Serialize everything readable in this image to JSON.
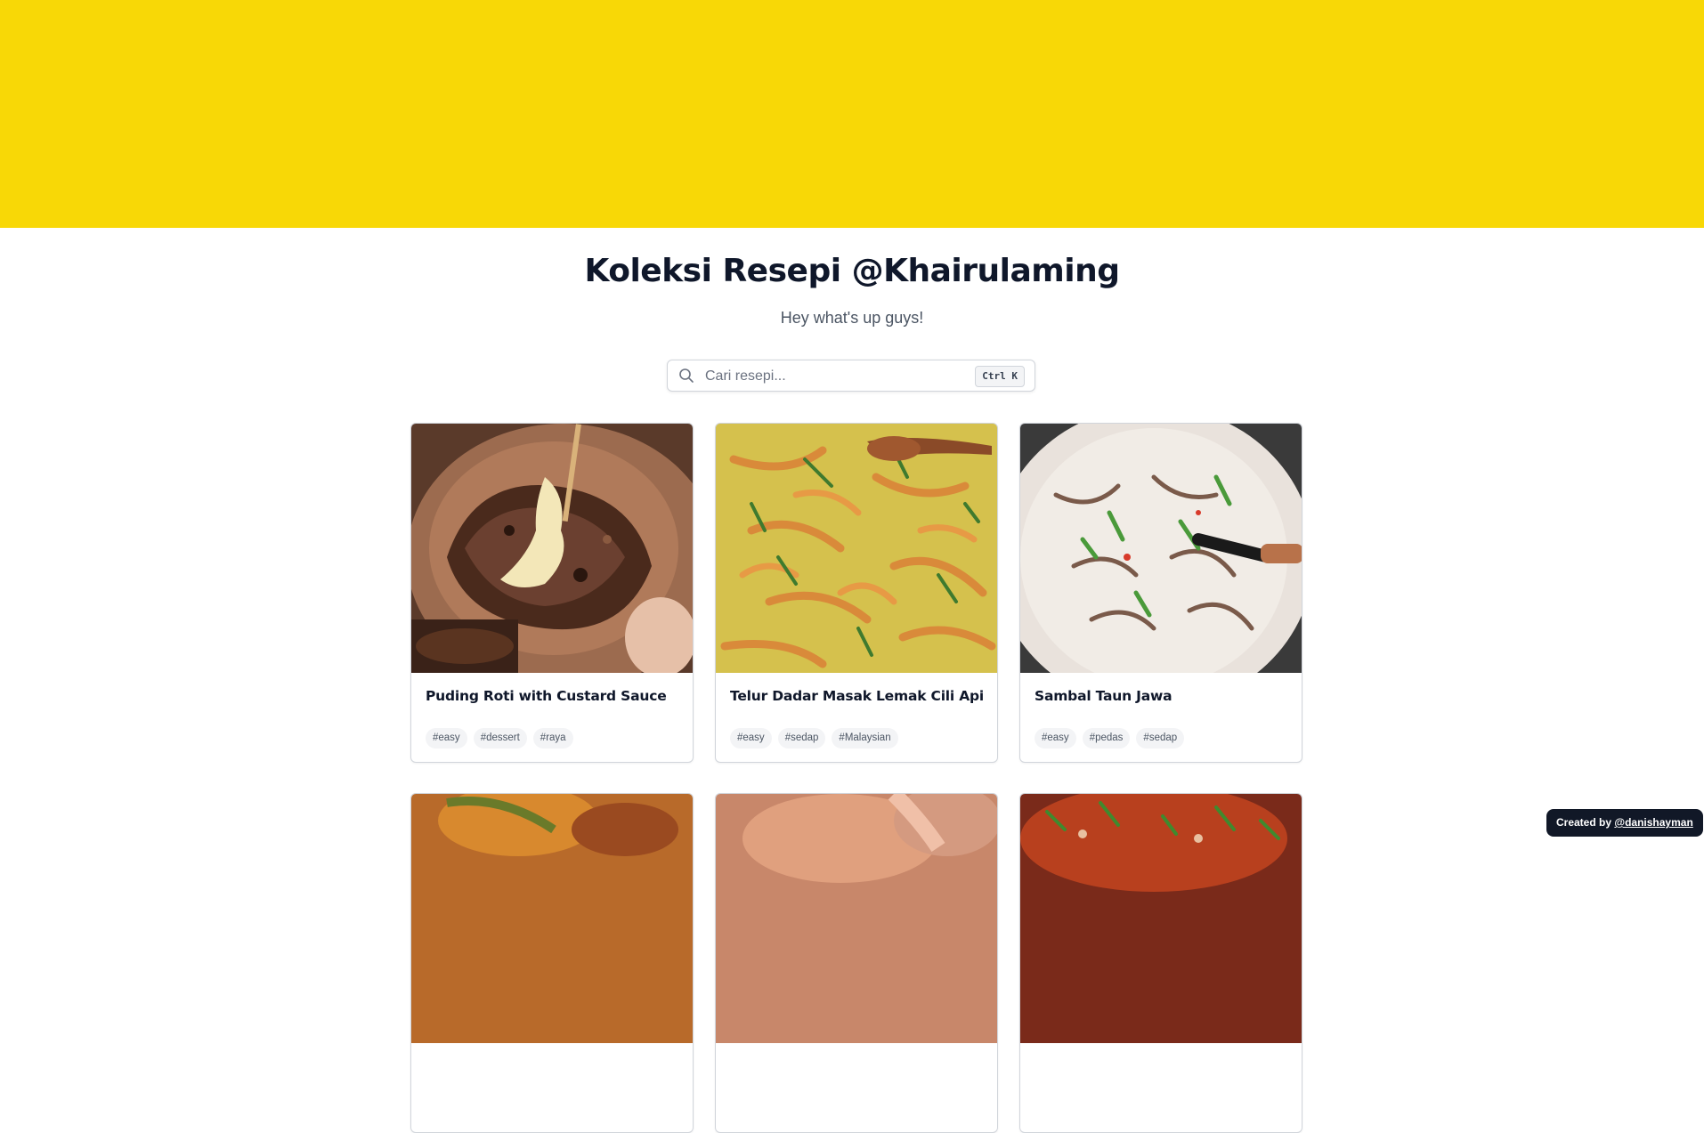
{
  "header": {
    "title": "Koleksi Resepi @Khairulaming",
    "subtitle": "Hey what's up guys!"
  },
  "search": {
    "placeholder": "Cari resepi...",
    "value": "",
    "shortcut": "Ctrl K",
    "icon": "search-icon"
  },
  "recipes": [
    {
      "title": "Puding Roti with Custard Sauce",
      "tags": [
        "#easy",
        "#dessert",
        "#raya"
      ]
    },
    {
      "title": "Telur Dadar Masak Lemak Cili Api",
      "tags": [
        "#easy",
        "#sedap",
        "#Malaysian"
      ]
    },
    {
      "title": "Sambal Taun Jawa",
      "tags": [
        "#easy",
        "#pedas",
        "#sedap"
      ]
    },
    {
      "title": "",
      "tags": []
    },
    {
      "title": "",
      "tags": []
    },
    {
      "title": "",
      "tags": []
    }
  ],
  "footer": {
    "credit_prefix": "Created by",
    "credit_link": "@danishayman"
  },
  "colors": {
    "banner": "#f8d806",
    "title": "#0f172a",
    "credit_bg": "#111827"
  }
}
